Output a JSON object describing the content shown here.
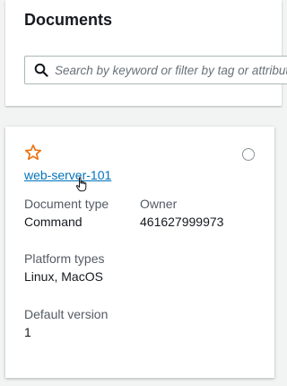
{
  "header": {
    "title": "Documents"
  },
  "search": {
    "placeholder": "Search by keyword or filter by tag or attributes",
    "icon": "search-icon"
  },
  "card": {
    "favorite_icon": "star-icon",
    "name": "web-server-101",
    "fields": {
      "document_type": {
        "label": "Document type",
        "value": "Command"
      },
      "owner": {
        "label": "Owner",
        "value": "461627999973"
      },
      "platform_types": {
        "label": "Platform types",
        "value": "Linux, MacOS"
      },
      "default_version": {
        "label": "Default version",
        "value": "1"
      }
    }
  },
  "colors": {
    "link": "#0073bb",
    "star": "#ec7211",
    "text": "#16191f",
    "label": "#545b64",
    "background": "#f2f3f3"
  }
}
